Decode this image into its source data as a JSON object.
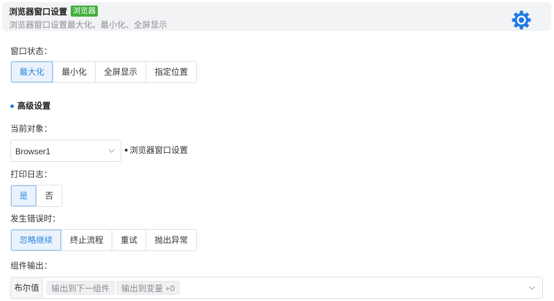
{
  "header": {
    "title": "浏览器窗口设置",
    "tag": "浏览器",
    "subtitle": "浏览器窗口设置最大化、最小化、全屏显示",
    "icon": "gear-icon",
    "accent": "#1f7ae0",
    "tag_color": "#3fae3b"
  },
  "window_state": {
    "label": "窗口状态：",
    "options": [
      "最大化",
      "最小化",
      "全屏显示",
      "指定位置"
    ],
    "selected": "最大化"
  },
  "advanced": {
    "title": "高级设置"
  },
  "current_object": {
    "label": "当前对象：",
    "value": "Browser1",
    "note": "浏览器窗口设置"
  },
  "print_log": {
    "label": "打印日志：",
    "options": [
      "是",
      "否"
    ],
    "selected": "是"
  },
  "on_error": {
    "label": "发生错误时：",
    "options": [
      "忽略继续",
      "终止流程",
      "重试",
      "抛出异常"
    ],
    "selected": "忽略继续"
  },
  "component_output": {
    "label": "组件输出：",
    "prefix": "布尔值",
    "chips": [
      "输出到下一组件",
      "输出到变量 +0"
    ]
  }
}
